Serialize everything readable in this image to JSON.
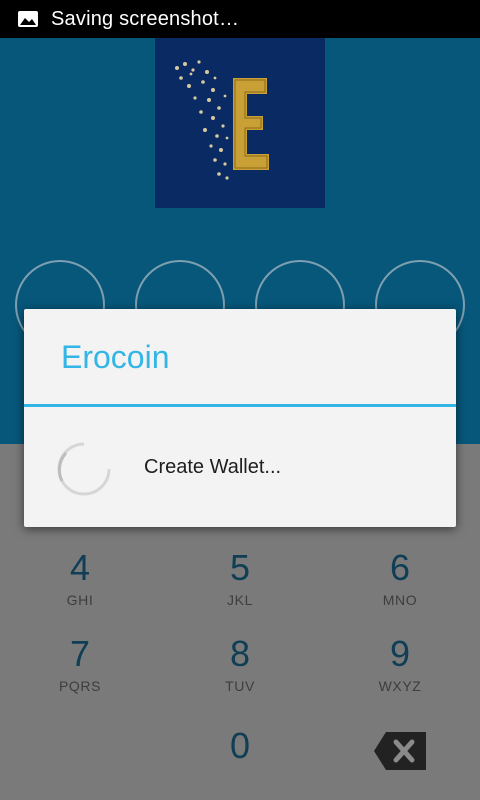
{
  "status_bar": {
    "notification_text": "Saving screenshot…",
    "icon": "image-icon"
  },
  "logo": {
    "letter": "E"
  },
  "pin": {
    "dots": 4
  },
  "keypad": {
    "keys": [
      {
        "digit": "4",
        "letters": "GHI"
      },
      {
        "digit": "5",
        "letters": "JKL"
      },
      {
        "digit": "6",
        "letters": "MNO"
      },
      {
        "digit": "7",
        "letters": "PQRS"
      },
      {
        "digit": "8",
        "letters": "TUV"
      },
      {
        "digit": "9",
        "letters": "WXYZ"
      },
      {
        "digit": "0",
        "letters": ""
      }
    ],
    "backspace_icon": "backspace-icon"
  },
  "dialog": {
    "title": "Erocoin",
    "message": "Create Wallet...",
    "spinner_icon": "spinner-icon"
  },
  "colors": {
    "accent": "#33b5e5",
    "top_bg": "#07577b",
    "logo_bg": "#0a2a63",
    "gold": "#c9a035"
  }
}
